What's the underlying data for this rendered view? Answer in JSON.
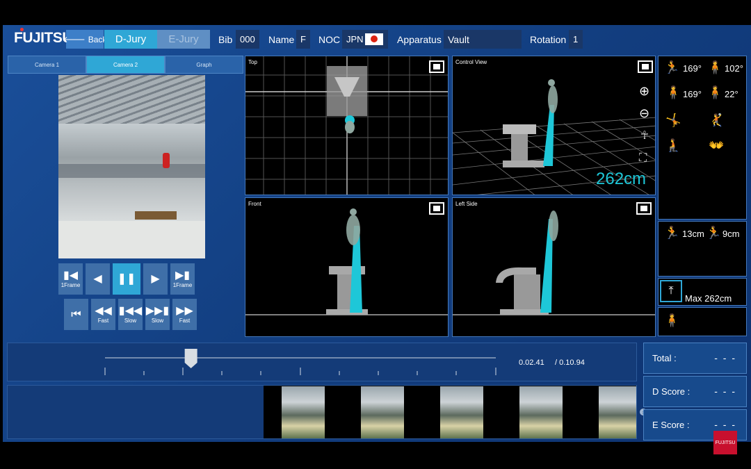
{
  "header": {
    "logo": "FUJITSU",
    "back_label": "Back",
    "tab_d": "D-Jury",
    "tab_e": "E-Jury",
    "bib_label": "Bib",
    "bib_value": "000",
    "name_label": "Name",
    "name_value": "F",
    "noc_label": "NOC",
    "noc_value": "JPN",
    "apparatus_label": "Apparatus",
    "apparatus_value": "Vault",
    "rotation_label": "Rotation",
    "rotation_value": "1"
  },
  "camera_tabs": [
    "Camera 1",
    "Camera 2",
    "Graph"
  ],
  "playback": {
    "row1": [
      {
        "icon": "step-back-icon",
        "glyph": "▮◀",
        "label": "1Frame"
      },
      {
        "icon": "play-reverse-icon",
        "glyph": "◀",
        "label": ""
      },
      {
        "icon": "pause-icon",
        "glyph": "❚❚",
        "label": ""
      },
      {
        "icon": "play-icon",
        "glyph": "▶",
        "label": ""
      },
      {
        "icon": "step-forward-icon",
        "glyph": "▶▮",
        "label": "1Frame"
      }
    ],
    "row2": [
      {
        "icon": "skip-start-icon",
        "glyph": "⏮",
        "label": ""
      },
      {
        "icon": "rewind-fast-icon",
        "glyph": "◀◀",
        "label": "Fast"
      },
      {
        "icon": "rewind-slow-icon",
        "glyph": "▮◀◀",
        "label": "Slow"
      },
      {
        "icon": "forward-slow-icon",
        "glyph": "▶▶▮",
        "label": "Slow"
      },
      {
        "icon": "forward-fast-icon",
        "glyph": "▶▶",
        "label": "Fast"
      }
    ]
  },
  "views": {
    "top": "Top",
    "control": "Control View",
    "front": "Front",
    "left_side": "Left Side",
    "height_readout": "262cm"
  },
  "angles": [
    "169°",
    "102°",
    "169°",
    "22°"
  ],
  "distances": [
    "13cm",
    "9cm"
  ],
  "max_height": "Max 262cm",
  "timeline": {
    "current": "0.02.41",
    "total": "/ 0.10.94",
    "progress": 0.22
  },
  "scores": [
    {
      "label": "Total :",
      "value": "- - -"
    },
    {
      "label": "D Score :",
      "value": "- - -"
    },
    {
      "label": "E Score :",
      "value": "- - -"
    }
  ],
  "watermark": "FUJITSU",
  "colors": {
    "accent": "#2fa7d6",
    "panel": "#1a4f9a",
    "readout": "#1ec7d8"
  }
}
